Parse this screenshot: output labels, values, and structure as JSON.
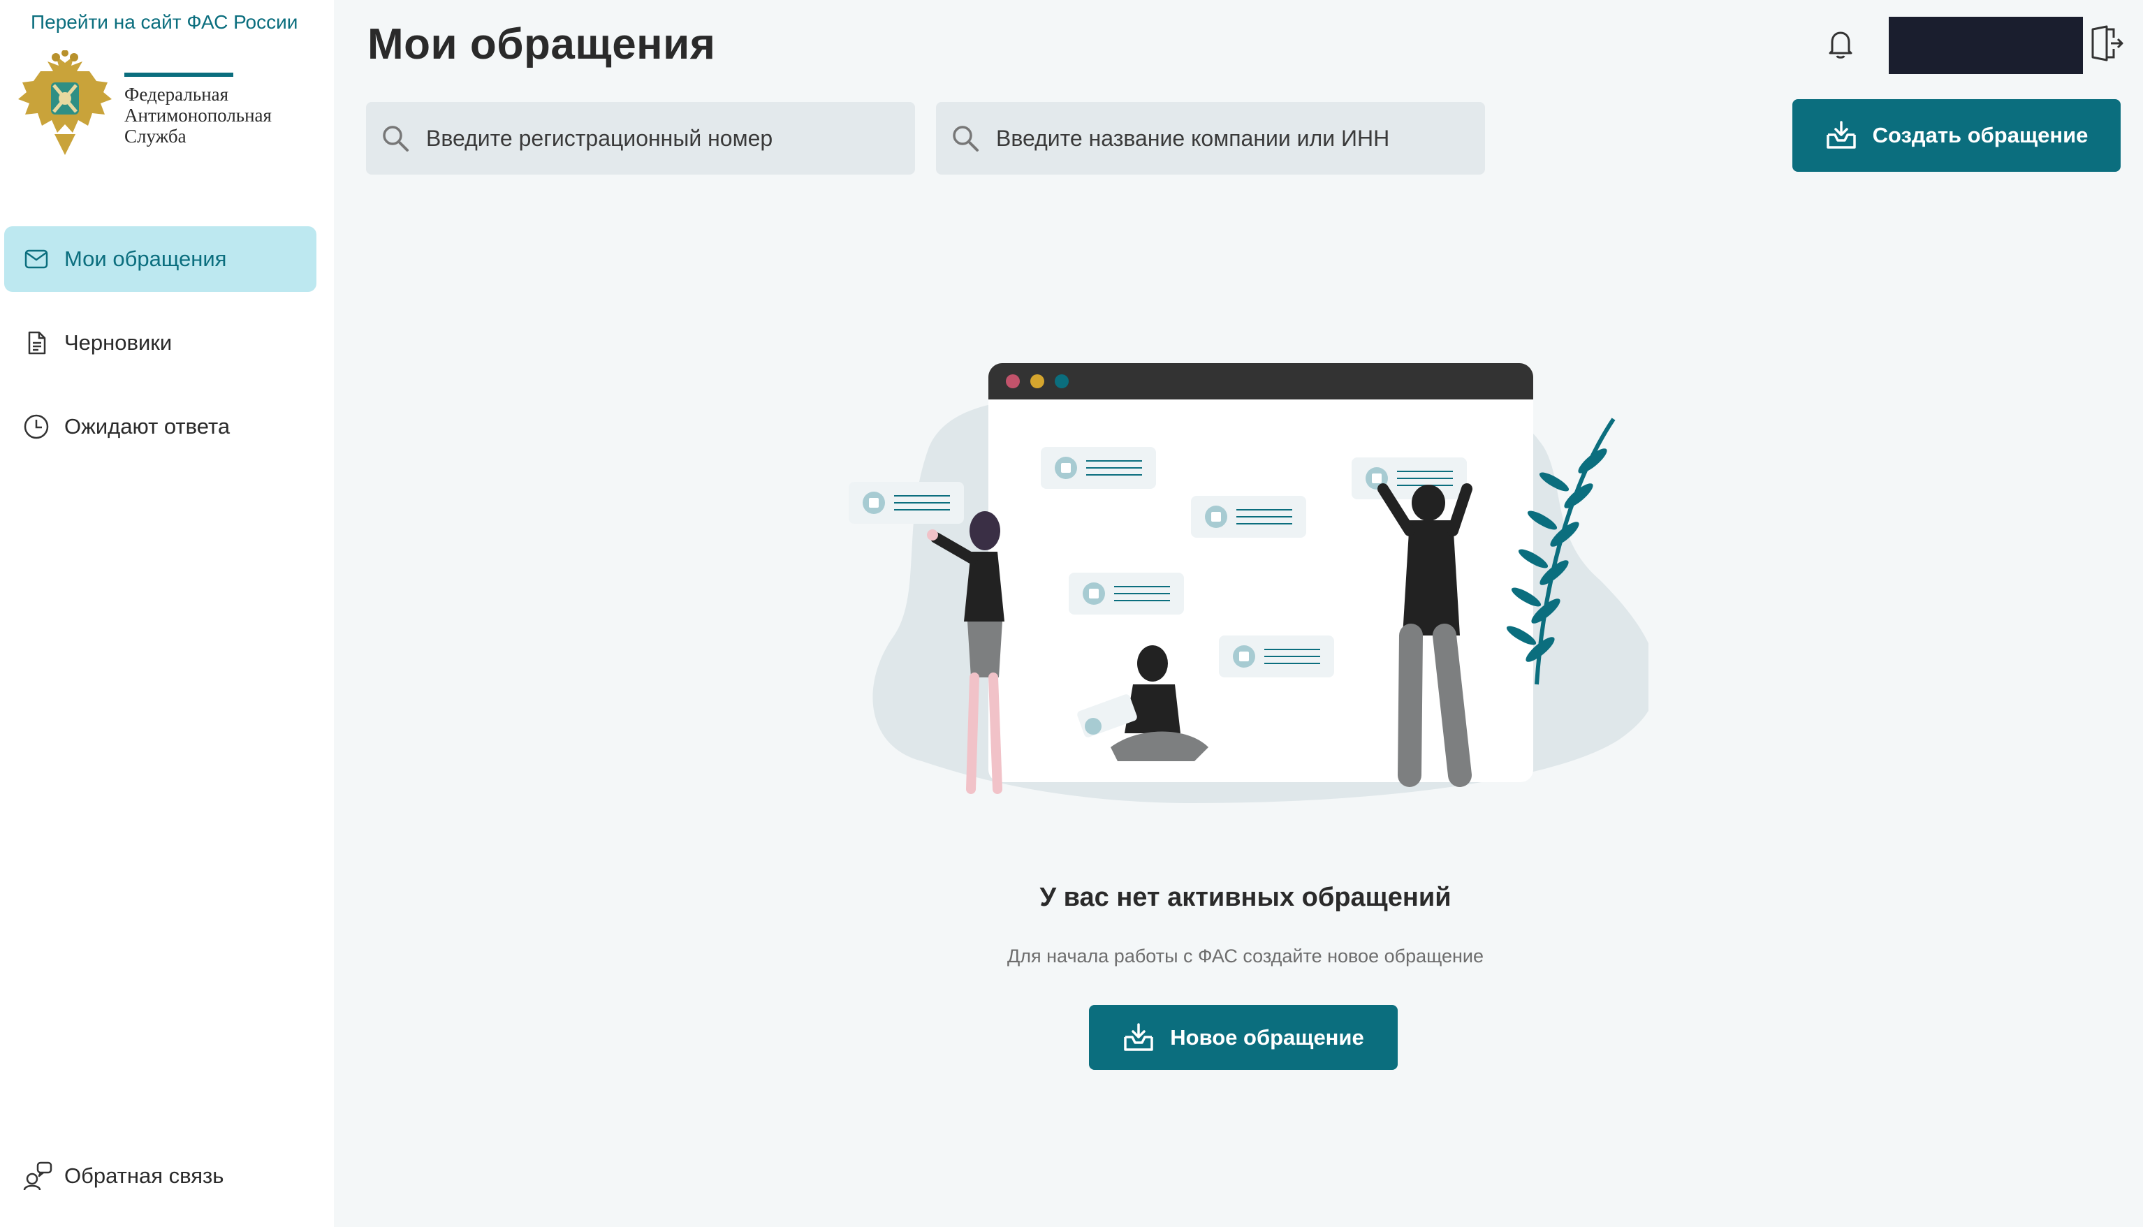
{
  "sidebar": {
    "fas_link": "Перейти на сайт ФАС России",
    "logo": {
      "line1": "Федеральная",
      "line2": "Антимонопольная",
      "line3": "Служба"
    },
    "items": [
      {
        "label": "Мои обращения",
        "icon": "envelope-icon",
        "active": true
      },
      {
        "label": "Черновики",
        "icon": "document-icon",
        "active": false
      },
      {
        "label": "Ожидают ответа",
        "icon": "clock-icon",
        "active": false
      }
    ],
    "feedback": {
      "label": "Обратная связь",
      "icon": "feedback-icon"
    }
  },
  "header": {
    "title": "Мои обращения",
    "icons": [
      "bell-icon",
      "logout-icon"
    ]
  },
  "search": {
    "registration_placeholder": "Введите регистрационный номер",
    "company_placeholder": "Введите название компании или ИНН"
  },
  "actions": {
    "create_label": "Создать обращение"
  },
  "empty_state": {
    "title": "У вас нет активных обращений",
    "subtitle": "Для начала работы с ФАС создайте новое обращение",
    "button_label": "Новое обращение"
  },
  "colors": {
    "accent": "#0b6e7e",
    "active_nav_bg": "#bde8f0",
    "page_bg": "#f4f7f8",
    "input_bg": "#e3e9ec"
  }
}
